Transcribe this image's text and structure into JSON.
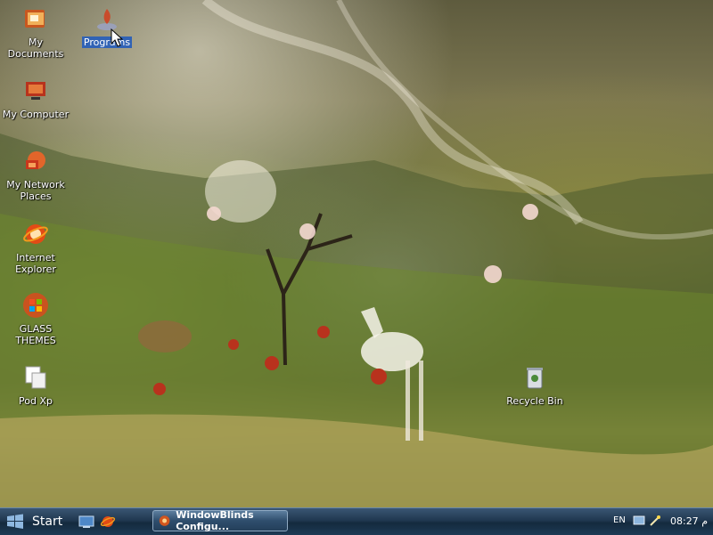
{
  "desktop": {
    "icons": [
      {
        "label": "My Documents",
        "icon": "folder-documents-icon"
      },
      {
        "label": "Programs",
        "icon": "programs-flame-icon"
      },
      {
        "label": "My Computer",
        "icon": "computer-icon"
      },
      {
        "label": "My Network Places",
        "icon": "network-icon"
      },
      {
        "label": "Internet Explorer",
        "icon": "internet-explorer-icon"
      },
      {
        "label": "GLASS THEMES",
        "icon": "windows-orb-icon"
      },
      {
        "label": "Pod Xp",
        "icon": "pod-xp-icon"
      },
      {
        "label": "Recycle Bin",
        "icon": "recycle-bin-icon"
      }
    ]
  },
  "taskbar": {
    "start_label": "Start",
    "task_button_label": "WindowBlinds Configu...",
    "language": "EN",
    "clock": "08:27 م"
  },
  "colors": {
    "taskbar": "#203850",
    "selection": "#3163b5"
  }
}
